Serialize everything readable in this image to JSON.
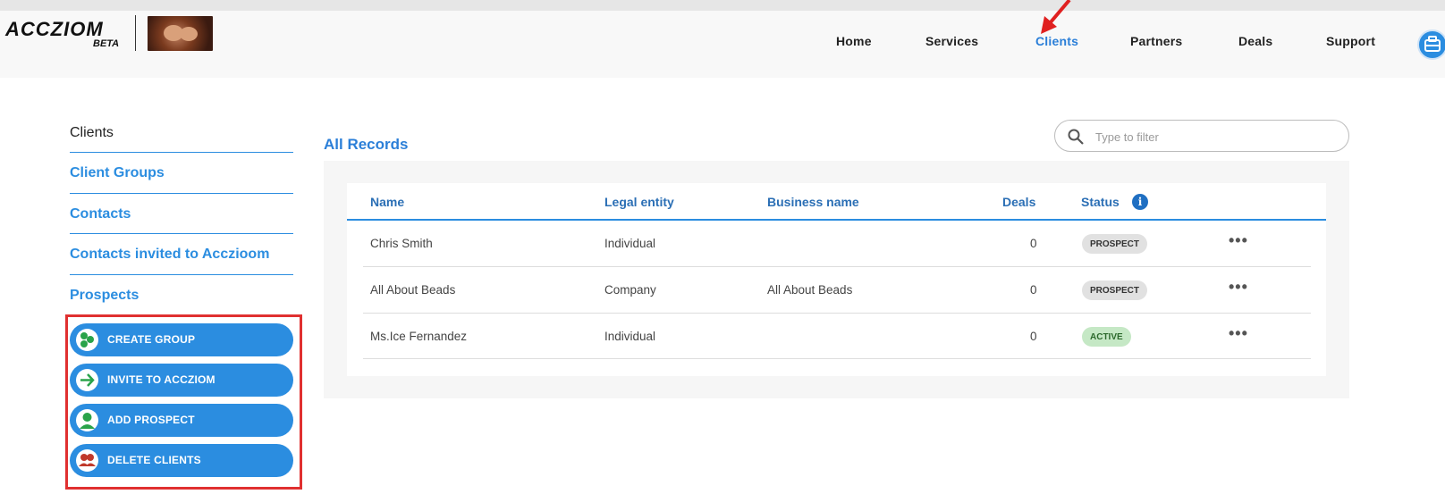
{
  "brand": {
    "name": "ACCZIOM",
    "tag": "BETA"
  },
  "nav": [
    "Home",
    "Services",
    "Clients",
    "Partners",
    "Deals",
    "Support"
  ],
  "nav_active": "Clients",
  "sidebar": {
    "items": [
      "Clients",
      "Client Groups",
      "Contacts",
      "Contacts invited to Acczioom",
      "Prospects"
    ]
  },
  "actions": [
    {
      "label": "CREATE GROUP",
      "icon": "group-icon"
    },
    {
      "label": "INVITE TO ACCZIOM",
      "icon": "arrow-right-icon"
    },
    {
      "label": "ADD PROSPECT",
      "icon": "person-icon"
    },
    {
      "label": "DELETE CLIENTS",
      "icon": "people-icon"
    }
  ],
  "main": {
    "title": "All Records",
    "filter_placeholder": "Type to filter",
    "columns": [
      "Name",
      "Legal entity",
      "Business name",
      "Deals",
      "Status"
    ],
    "rows": [
      {
        "name": "Chris Smith",
        "legal_entity": "Individual",
        "business_name": "",
        "deals": "0",
        "status": "PROSPECT"
      },
      {
        "name": "All About Beads",
        "legal_entity": "Company",
        "business_name": "All About Beads",
        "deals": "0",
        "status": "PROSPECT"
      },
      {
        "name": "Ms.Ice Fernandez",
        "legal_entity": "Individual",
        "business_name": "",
        "deals": "0",
        "status": "ACTIVE"
      }
    ],
    "row_menu": "•••",
    "info_glyph": "i"
  },
  "colors": {
    "accent": "#2b8de0",
    "highlight_box": "#e03030",
    "arrow": "#e02020"
  }
}
